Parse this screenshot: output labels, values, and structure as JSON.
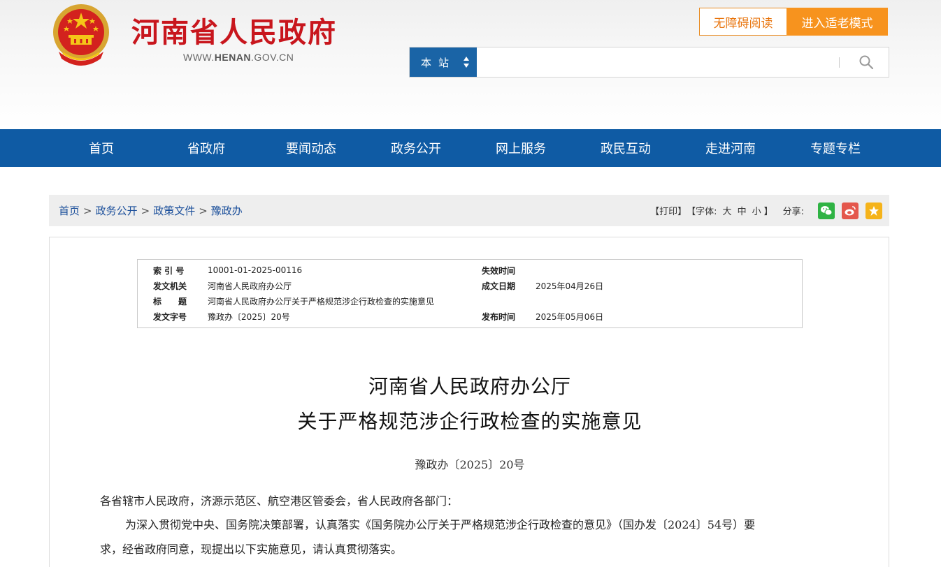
{
  "header": {
    "site_title": "河南省人民政府",
    "site_url_prefix": "WWW.",
    "site_url_bold": "HENAN",
    "site_url_suffix": ".GOV.CN",
    "accessibility_button": "无障碍阅读",
    "elder_mode_button": "进入适老模式",
    "search_scope": "本站",
    "search_placeholder": ""
  },
  "nav": {
    "items": [
      "首页",
      "省政府",
      "要闻动态",
      "政务公开",
      "网上服务",
      "政民互动",
      "走进河南",
      "专题专栏"
    ]
  },
  "breadcrumb": {
    "items": [
      "首页",
      "政务公开",
      "政策文件",
      "豫政办"
    ],
    "separator": ">"
  },
  "tools": {
    "print": "【打印】",
    "font_label": "【字体:",
    "font_large": "大",
    "font_medium": "中",
    "font_small": "小",
    "font_close": "】",
    "share_label": "分享:",
    "share_icons": [
      "wechat-icon",
      "weibo-icon",
      "favorite-icon"
    ]
  },
  "meta": {
    "index_label": "索 引 号",
    "index_value": "10001-01-2025-00116",
    "expire_label": "失效时间",
    "expire_value": "",
    "issuer_label": "发文机关",
    "issuer_value": "河南省人民政府办公厅",
    "date_label": "成文日期",
    "date_value": "2025年04月26日",
    "title_label": "标　　题",
    "title_value": "河南省人民政府办公厅关于严格规范涉企行政检查的实施意见",
    "docno_label": "发文字号",
    "docno_value": "豫政办〔2025〕20号",
    "publish_label": "发布时间",
    "publish_value": "2025年05月06日"
  },
  "document": {
    "title_line1": "河南省人民政府办公厅",
    "title_line2": "关于严格规范涉企行政检查的实施意见",
    "doc_number": "豫政办〔2025〕20号",
    "salutation": "各省辖市人民政府，济源示范区、航空港区管委会，省人民政府各部门：",
    "para1_line1": "为深入贯彻党中央、国务院决策部署，认真落实《国务院办公厅关于严格规范涉企行政检查的意见》（国办发〔2024〕54号）要",
    "para1_line2": "求，经省政府同意，现提出以下实施意见，请认真贯彻落实。"
  },
  "colors": {
    "brand_red": "#c8161d",
    "nav_blue": "#0f5ba4",
    "orange": "#f7931e",
    "link_blue": "#1a4e9a"
  }
}
